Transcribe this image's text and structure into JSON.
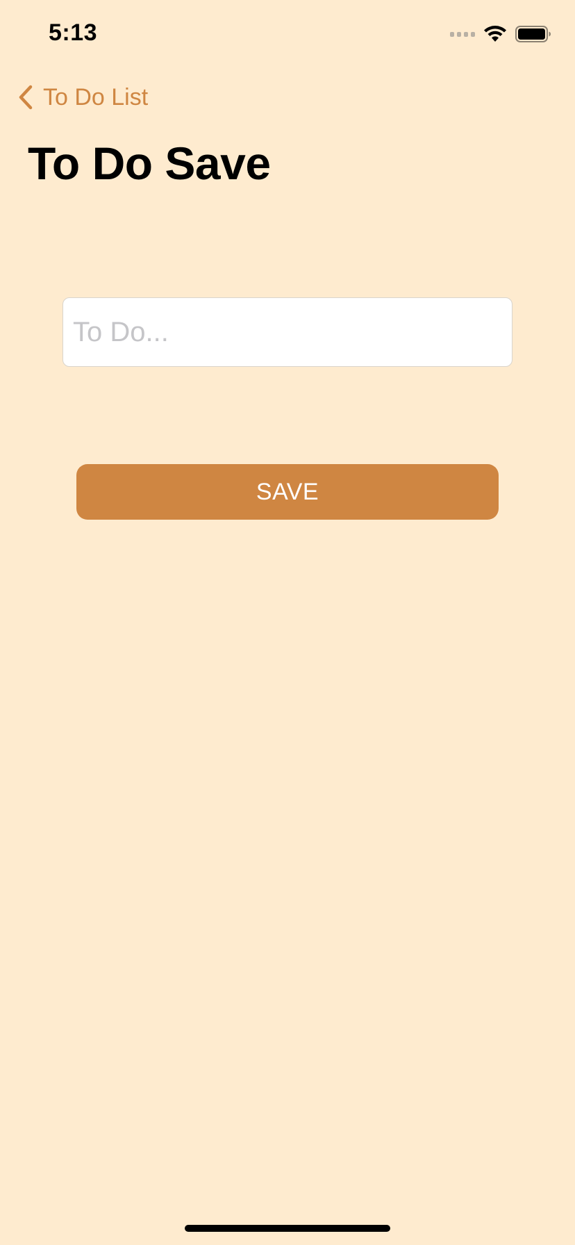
{
  "status_bar": {
    "time": "5:13",
    "icons": [
      "signal-icon",
      "wifi-icon",
      "battery-icon"
    ]
  },
  "nav": {
    "back_label": "To Do List",
    "back_icon": "chevron-left-icon"
  },
  "page": {
    "title": "To Do Save"
  },
  "form": {
    "todo_input": {
      "placeholder": "To Do...",
      "value": ""
    },
    "save_label": "SAVE"
  },
  "colors": {
    "background": "#feebcf",
    "accent": "#cf8642",
    "button_text": "#ffffff",
    "placeholder": "#c5c5c8"
  }
}
